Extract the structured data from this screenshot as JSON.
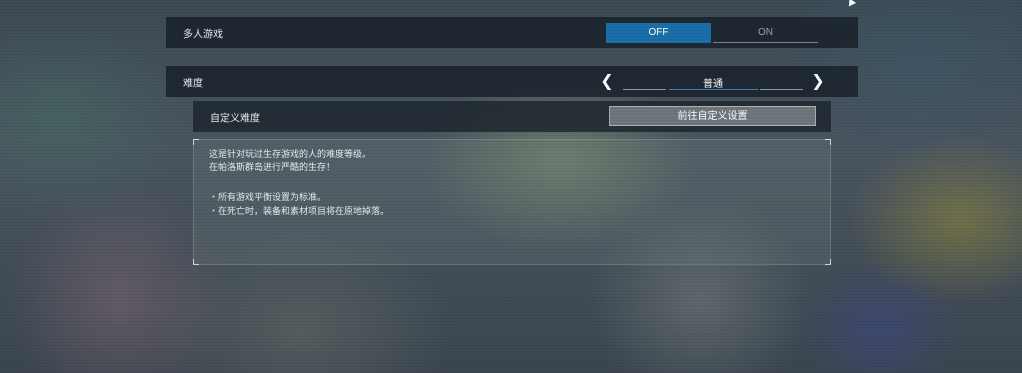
{
  "multiplayer": {
    "label": "多人游戏",
    "off_label": "OFF",
    "on_label": "ON",
    "selected": "OFF",
    "accent_color": "#1b6fa8"
  },
  "difficulty": {
    "label": "难度",
    "value": "普通",
    "prev_icon": "chevron-left-icon",
    "next_icon": "chevron-right-icon"
  },
  "custom_difficulty": {
    "label": "自定义难度",
    "button_label": "前往自定义设置"
  },
  "description": {
    "line1": "这是针对玩过生存游戏的人的难度等级。",
    "line2": "在帕洛斯群岛进行严酷的生存！",
    "bullet1": "・所有游戏平衡设置为标准。",
    "bullet2": "・在死亡时，装备和素材项目将在原地掉落。"
  }
}
